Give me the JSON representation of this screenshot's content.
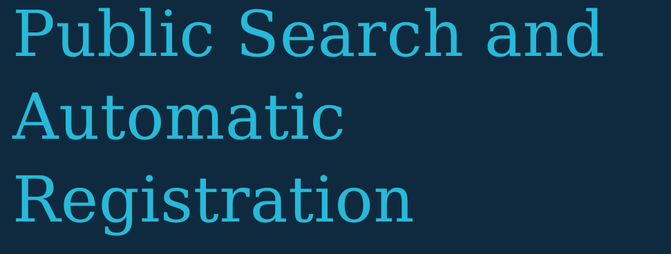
{
  "background_color": "#0f2a3e",
  "text_color": "#27b9d9",
  "heading": {
    "lines": [
      "Public Search and",
      "Automatic",
      "Registration"
    ]
  }
}
